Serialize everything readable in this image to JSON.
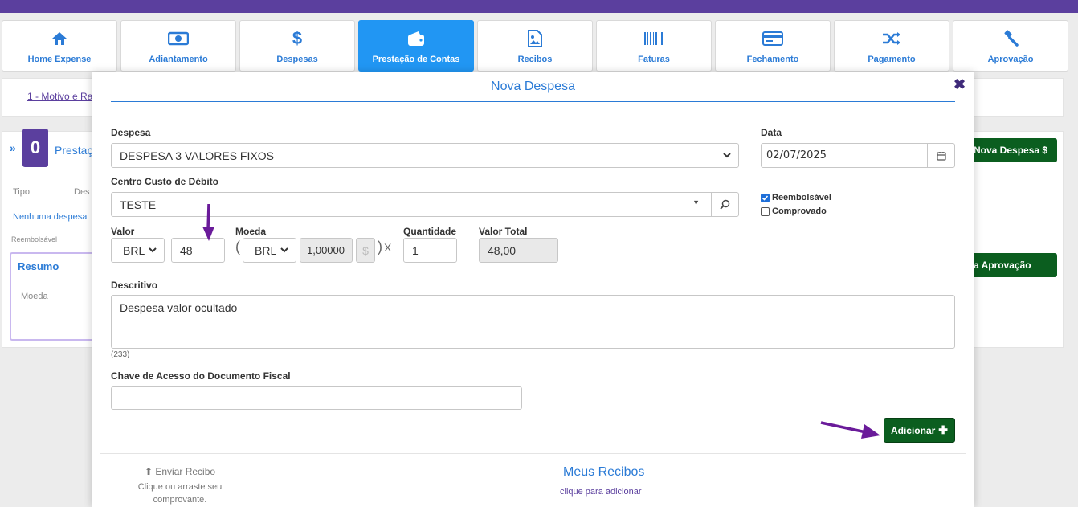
{
  "nav": [
    {
      "label": "Home Expense",
      "icon": "home-icon",
      "active": false
    },
    {
      "label": "Adiantamento",
      "icon": "banknote-icon",
      "active": false
    },
    {
      "label": "Despesas",
      "icon": "dollar-icon",
      "active": false
    },
    {
      "label": "Prestação de Contas",
      "icon": "wallet-icon",
      "active": true
    },
    {
      "label": "Recibos",
      "icon": "image-icon",
      "active": false
    },
    {
      "label": "Faturas",
      "icon": "barcode-icon",
      "active": false
    },
    {
      "label": "Fechamento",
      "icon": "credit-card-icon",
      "active": false
    },
    {
      "label": "Pagamento",
      "icon": "shuffle-icon",
      "active": false
    },
    {
      "label": "Aprovação",
      "icon": "gavel-icon",
      "active": false
    }
  ],
  "background": {
    "step_link": "1 - Motivo e Ra",
    "count": "0",
    "section_title": "Prestaç",
    "col_tipo": "Tipo",
    "col_des": "Des",
    "empty": "Nenhuma despesa",
    "reembolsavel": "Reembolsável",
    "resumo": "Resumo",
    "moeda": "Moeda",
    "btn_nova": "Nova Despesa $",
    "btn_aprov": "a Aprovação"
  },
  "modal": {
    "title": "Nova Despesa",
    "despesa_label": "Despesa",
    "despesa_value": "DESPESA 3 VALORES FIXOS",
    "data_label": "Data",
    "data_value": "02/07/2025",
    "centro_label": "Centro Custo de Débito",
    "centro_value": "TESTE",
    "reembolsavel_label": "Reembolsável",
    "reembolsavel_checked": true,
    "comprovado_label": "Comprovado",
    "comprovado_checked": false,
    "valor_label": "Valor",
    "valor_currency": "BRL",
    "valor_value": "48",
    "moeda_label": "Moeda",
    "moeda_currency": "BRL",
    "moeda_rate": "1,00000",
    "rate_symbol": "$",
    "times": "X",
    "paren_open": "(",
    "paren_close": ")",
    "quantidade_label": "Quantidade",
    "quantidade_value": "1",
    "valor_total_label": "Valor Total",
    "valor_total_value": "48,00",
    "descritivo_label": "Descritivo",
    "descritivo_value": "Despesa valor ocultado",
    "char_count": "(233)",
    "chave_label": "Chave de Acesso do Documento Fiscal",
    "chave_value": "",
    "add_button": "Adicionar",
    "upload_title": "Enviar Recibo",
    "upload_hint_1": "Clique ou arraste seu",
    "upload_hint_2": "comprovante.",
    "recibos_title": "Meus Recibos",
    "recibos_sub": "clique para adicionar"
  },
  "colors": {
    "brand": "#5b3f9e",
    "accent": "#2196f3",
    "add_button": "#0b5e1f",
    "arrow": "#6a1b9a"
  }
}
